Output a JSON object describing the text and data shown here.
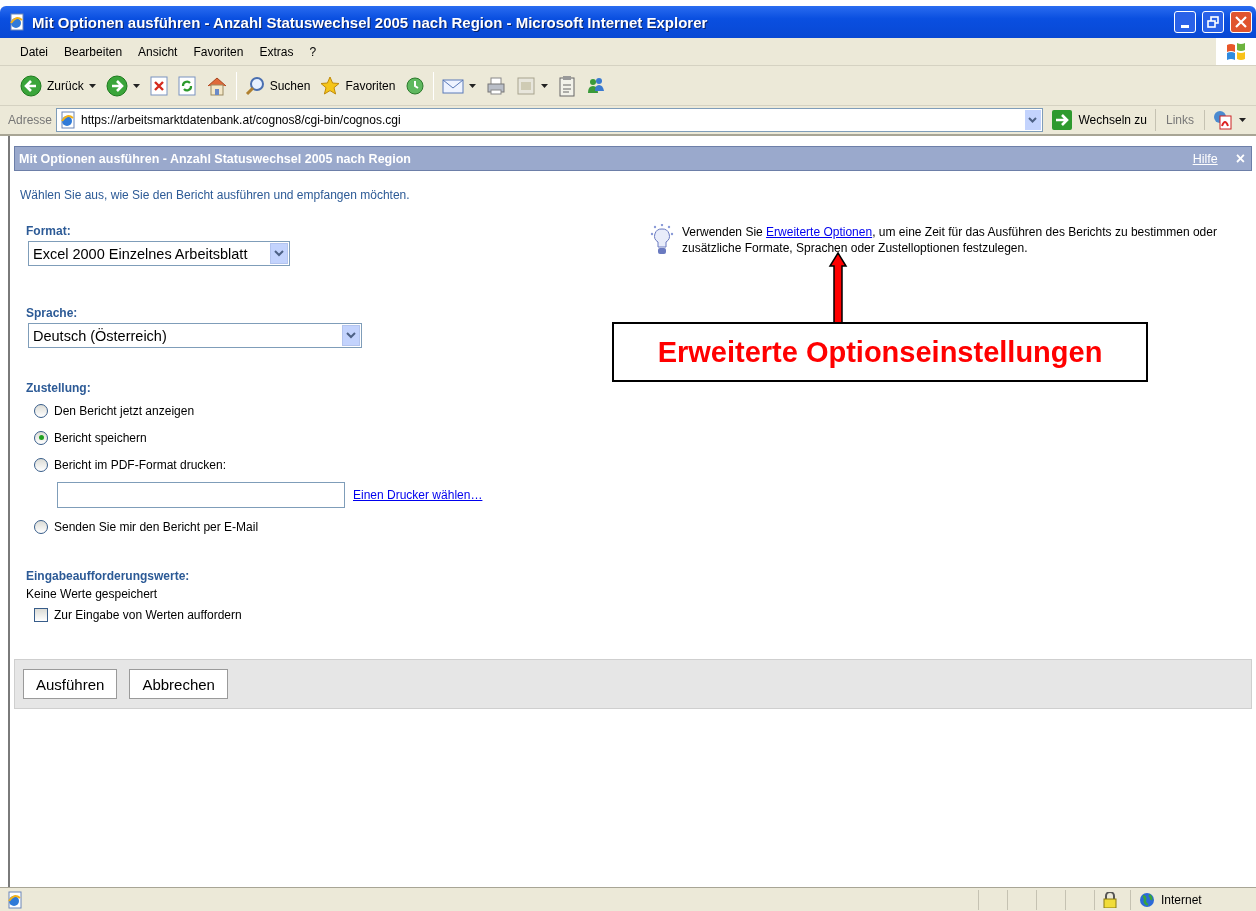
{
  "window": {
    "title": "Mit Optionen ausführen - Anzahl Statuswechsel 2005 nach Region - Microsoft Internet Explorer"
  },
  "menu": [
    "Datei",
    "Bearbeiten",
    "Ansicht",
    "Favoriten",
    "Extras",
    "?"
  ],
  "toolbar": {
    "groups": [
      [
        {
          "kind": "back",
          "label": "Zurück",
          "menu": true
        },
        {
          "kind": "forward",
          "menu": true
        },
        {
          "kind": "stop",
          "menu": false
        },
        {
          "kind": "refresh",
          "menu": false
        },
        {
          "kind": "home",
          "menu": false
        }
      ],
      [
        {
          "kind": "search",
          "label": "Suchen",
          "menu": false
        },
        {
          "kind": "favorites",
          "label": "Favoriten",
          "menu": false
        },
        {
          "kind": "history",
          "menu": false
        }
      ],
      [
        {
          "kind": "mail",
          "menu": true
        },
        {
          "kind": "print",
          "menu": false
        },
        {
          "kind": "edit",
          "menu": true
        },
        {
          "kind": "discuss",
          "menu": false
        },
        {
          "kind": "messenger",
          "menu": false
        }
      ]
    ]
  },
  "address": {
    "label": "Adresse",
    "url": "https://arbeitsmarktdatenbank.at/cognos8/cgi-bin/cognos.cgi",
    "go_label": "Wechseln zu",
    "links_label": "Links"
  },
  "dialog": {
    "title": "Mit Optionen ausführen - Anzahl Statuswechsel 2005 nach Region",
    "help_link": "Hilfe",
    "close": "×",
    "intro": "Wählen Sie aus, wie Sie den Bericht ausführen und empfangen möchten.",
    "format": {
      "label": "Format:",
      "value": "Excel 2000 Einzelnes Arbeitsblatt"
    },
    "language": {
      "label": "Sprache:",
      "value": "Deutsch (Österreich)"
    },
    "delivery": {
      "label": "Zustellung:",
      "options": [
        {
          "kind": "plain",
          "label": "Den Bericht jetzt anzeigen",
          "selected": false
        },
        {
          "kind": "plain",
          "label": "Bericht speichern",
          "selected": true
        },
        {
          "kind": "printer",
          "label": "Bericht im PDF-Format drucken:",
          "selected": false,
          "link": "Einen Drucker wählen…"
        },
        {
          "kind": "plain",
          "label": "Senden Sie mir den Bericht per E-Mail",
          "selected": false
        }
      ]
    },
    "prompts": {
      "label": "Eingabeaufforderungswerte:",
      "note": "Keine Werte gespeichert",
      "checkbox": {
        "label": "Zur Eingabe von Werten auffordern",
        "checked": false
      }
    },
    "hint": {
      "before": "Verwenden Sie ",
      "link": "Erweiterte Optionen",
      "after": ", um eine Zeit für das Ausführen des Berichts zu bestimmen oder zusätzliche Formate, Sprachen oder Zustelloptionen festzulegen."
    },
    "buttons": [
      "Ausführen",
      "Abbrechen"
    ]
  },
  "annotation": {
    "text": "Erweiterte Optionseinstellungen"
  },
  "status_bar": {
    "zone": "Internet"
  }
}
